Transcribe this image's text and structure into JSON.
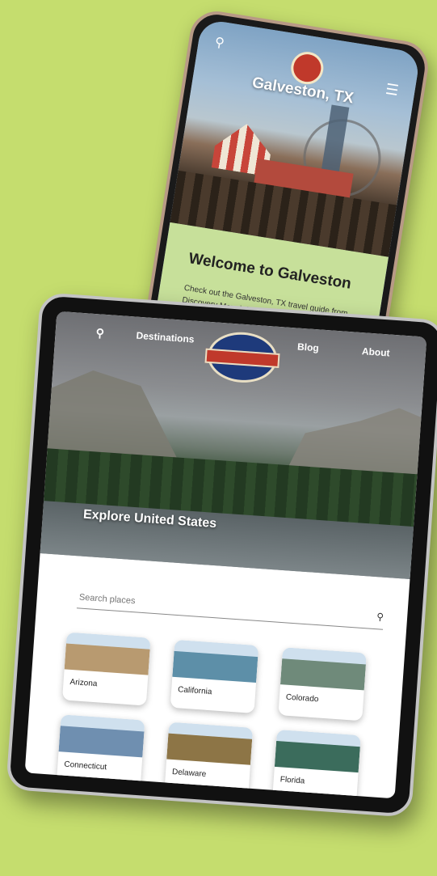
{
  "phone": {
    "title": "Galveston, TX",
    "heading": "Welcome to Galveston",
    "intro_line1": "Check out the Galveston, TX travel guide from",
    "intro_line2": "Discovery Map: info on..."
  },
  "tablet": {
    "nav": {
      "destinations": "Destinations",
      "blog": "Blog",
      "about": "About"
    },
    "hero_title": "Explore United States",
    "search_placeholder": "Search places",
    "cards": [
      {
        "label": "Arizona",
        "color": "#b89a70"
      },
      {
        "label": "California",
        "color": "#5d8fa8"
      },
      {
        "label": "Colorado",
        "color": "#6f8a7a"
      },
      {
        "label": "Connecticut",
        "color": "#6f8fb0"
      },
      {
        "label": "Delaware",
        "color": "#8d7546"
      },
      {
        "label": "Florida",
        "color": "#3b6c5c"
      }
    ]
  },
  "colors": {
    "background": "#c5dd6e",
    "phone_panel": "#c7e09a"
  },
  "icons": {
    "search": "search-icon",
    "menu": "hamburger-menu-icon",
    "logo": "discovery-map-logo"
  }
}
